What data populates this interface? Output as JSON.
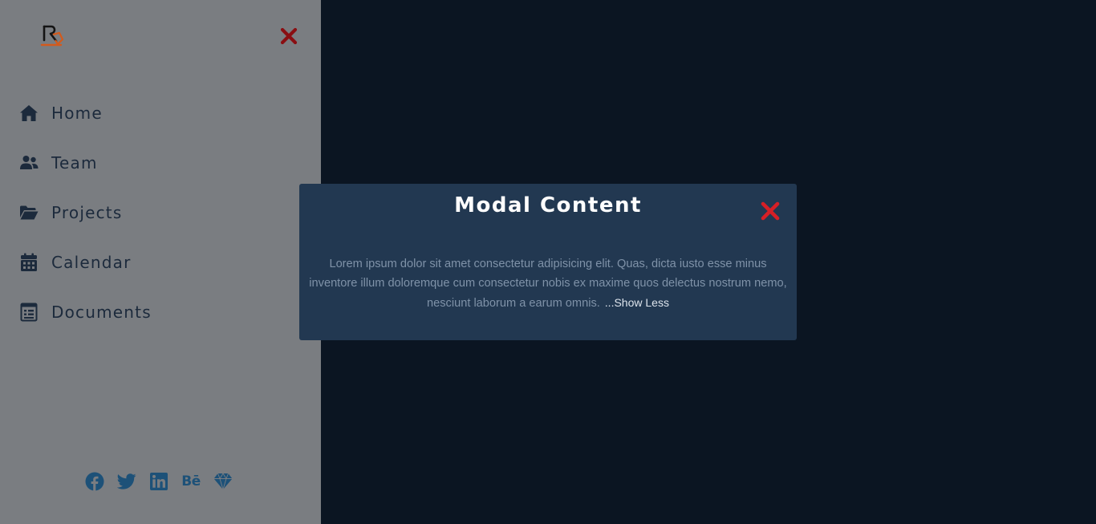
{
  "colors": {
    "sidebar_bg": "#7a7d81",
    "page_bg": "#0b1522",
    "modal_bg": "#223851",
    "close_red": "#d61f26",
    "sidebar_close_red": "#8a0e12",
    "nav_text": "#1c2a3c",
    "social_blue": "#1d5178",
    "logo_orange": "#d35a1c"
  },
  "sidebar": {
    "logo": {
      "icon": "rb-logo-icon"
    },
    "close_icon": "close-icon",
    "nav": [
      {
        "label": "Home",
        "icon": "home-icon"
      },
      {
        "label": "Team",
        "icon": "users-icon"
      },
      {
        "label": "Projects",
        "icon": "folder-open-icon"
      },
      {
        "label": "Calendar",
        "icon": "calendar-icon"
      },
      {
        "label": "Documents",
        "icon": "document-icon"
      }
    ],
    "social": [
      {
        "icon": "facebook-icon"
      },
      {
        "icon": "twitter-icon"
      },
      {
        "icon": "linkedin-icon"
      },
      {
        "icon": "behance-icon",
        "text": "Bē"
      },
      {
        "icon": "sketch-icon"
      }
    ]
  },
  "modal": {
    "title": "Modal Content",
    "body": "Lorem ipsum dolor sit amet consectetur adipisicing elit. Quas, dicta iusto esse minus inventore illum doloremque cum consectetur nobis ex maxime quos delectus nostrum nemo, nesciunt laborum a earum omnis.",
    "toggle_label": "...Show Less",
    "close_icon": "close-icon"
  }
}
